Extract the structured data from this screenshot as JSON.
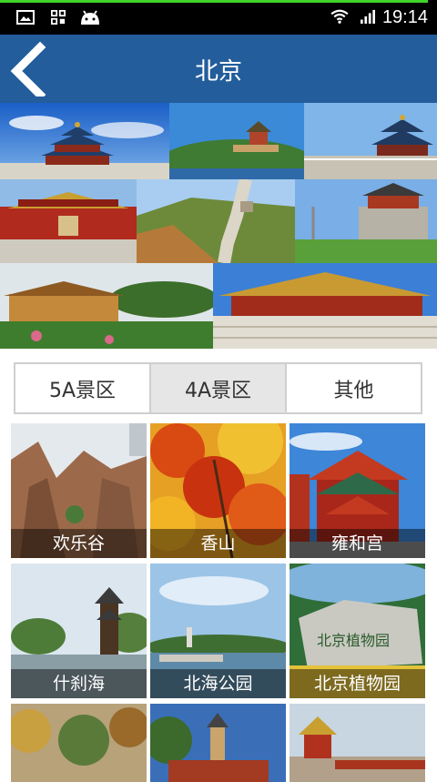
{
  "status_bar": {
    "time": "19:14"
  },
  "app_bar": {
    "title": "北京"
  },
  "tabs": [
    {
      "label": "5A景区",
      "selected": false
    },
    {
      "label": "4A景区",
      "selected": true
    },
    {
      "label": "其他",
      "selected": false
    }
  ],
  "attractions": [
    {
      "name": "欢乐谷"
    },
    {
      "name": "香山"
    },
    {
      "name": "雍和宫"
    },
    {
      "name": "什刹海"
    },
    {
      "name": "北海公园"
    },
    {
      "name": "北京植物园"
    },
    {
      "name": ""
    },
    {
      "name": ""
    },
    {
      "name": ""
    }
  ],
  "colors": {
    "app_bar": "#235d9c",
    "status_bar": "#000000"
  }
}
